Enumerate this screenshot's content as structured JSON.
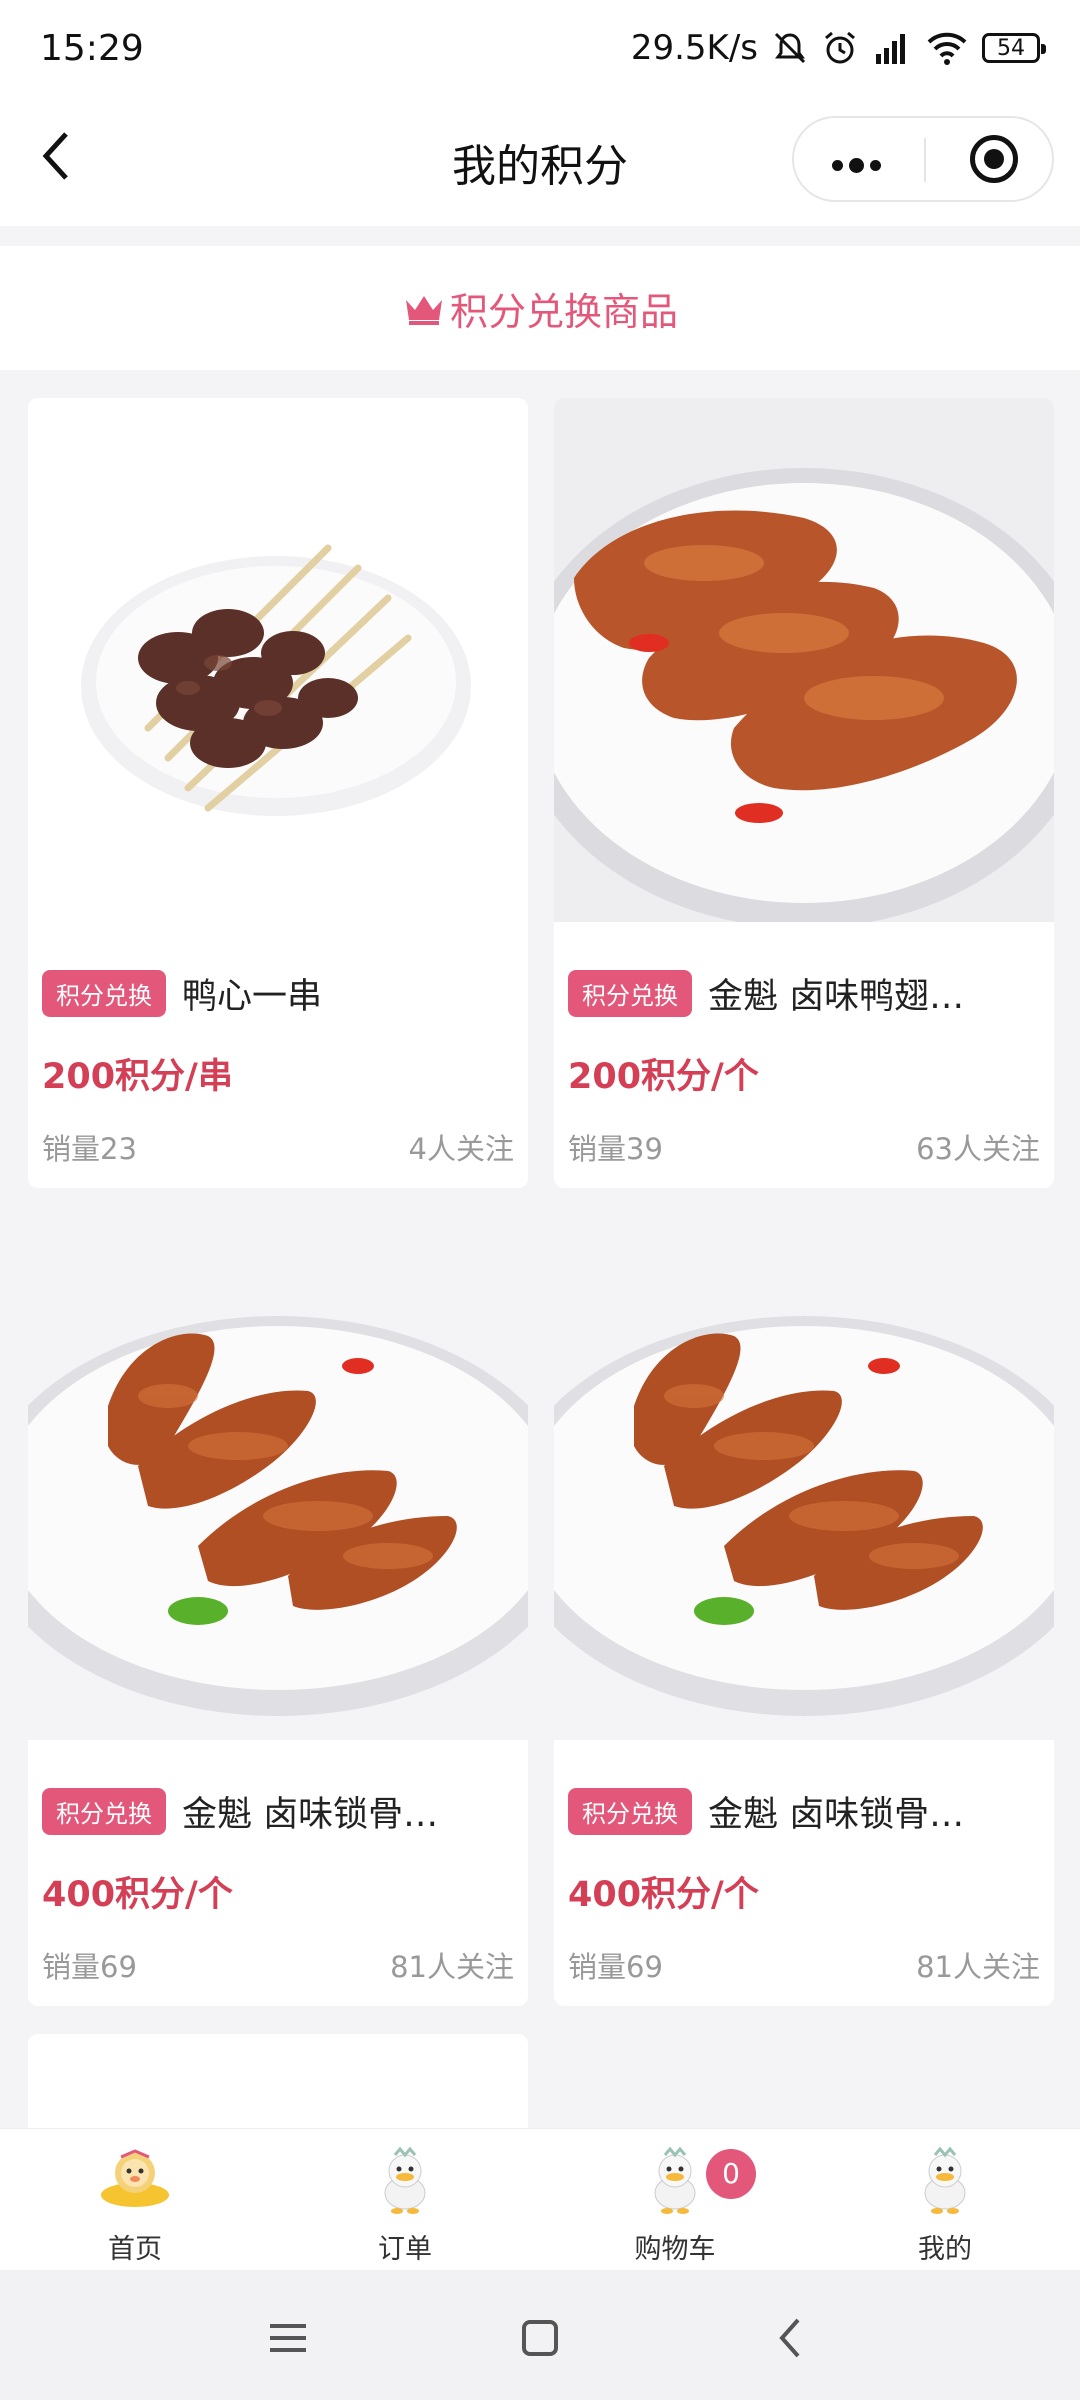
{
  "status_bar": {
    "time": "15:29",
    "speed": "29.5K/s",
    "battery": "54",
    "icons": [
      "mute-bell-icon",
      "alarm-icon",
      "signal-icon",
      "wifi-icon",
      "battery-icon"
    ]
  },
  "nav": {
    "title": "我的积分",
    "back_icon": "chevron-left-icon",
    "menu_icon": "more-dots-icon",
    "close_icon": "target-icon"
  },
  "section": {
    "title": "积分兑换商品",
    "icon": "crown-icon",
    "accent": "#e3587a"
  },
  "products": [
    {
      "tag": "积分兑换",
      "name": "鸭心一串",
      "price": "200积分/串",
      "sales": "销量23",
      "followers": "4人关注",
      "image": "duck-heart-skewer"
    },
    {
      "tag": "积分兑换",
      "name": "金魁 卤味鸭翅…",
      "price": "200积分/个",
      "sales": "销量39",
      "followers": "63人关注",
      "image": "braised-duck-wings"
    },
    {
      "tag": "积分兑换",
      "name": "金魁 卤味锁骨…",
      "price": "400积分/个",
      "sales": "销量69",
      "followers": "81人关注",
      "image": "braised-duck-collarbone"
    },
    {
      "tag": "积分兑换",
      "name": "金魁 卤味锁骨…",
      "price": "400积分/个",
      "sales": "销量69",
      "followers": "81人关注",
      "image": "braised-duck-collarbone"
    }
  ],
  "tabs": [
    {
      "label": "首页",
      "icon": "home-mascot-icon"
    },
    {
      "label": "订单",
      "icon": "orders-duck-icon"
    },
    {
      "label": "购物车",
      "icon": "cart-duck-icon",
      "badge": "0"
    },
    {
      "label": "我的",
      "icon": "profile-duck-icon"
    }
  ],
  "colors": {
    "price": "#d43f55",
    "tag": "#e3587a"
  }
}
